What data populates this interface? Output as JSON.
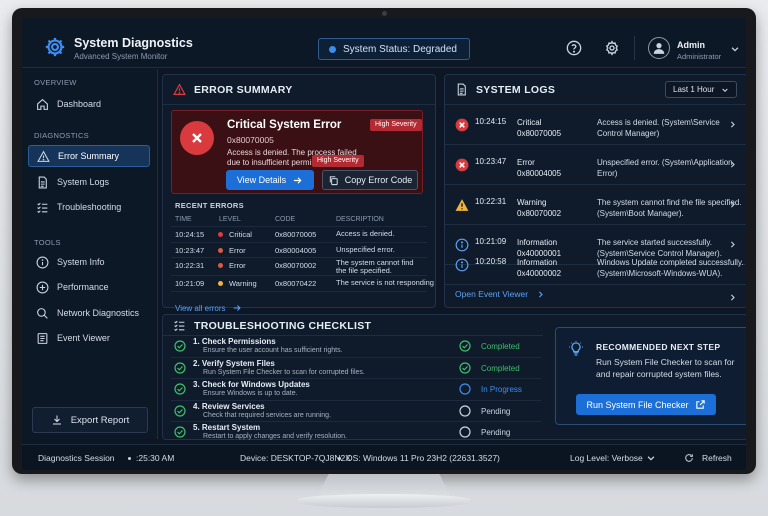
{
  "app": {
    "title": "System Diagnostics",
    "subtitle": "Advanced System Monitor"
  },
  "status": {
    "text": "System Status: Degraded",
    "color": "#3b8ef0"
  },
  "user": {
    "name": "Admin",
    "role": "Administrator"
  },
  "header_icons": [
    "help-icon",
    "gear-icon",
    "user-icon",
    "chevron-down-icon"
  ],
  "sidebar": {
    "overview_label": "OVERVIEW",
    "diagnostics_label": "DIAGNOSTICS",
    "tools_label": "TOOLS",
    "items": [
      {
        "label": "Dashboard",
        "icon": "home-icon"
      },
      {
        "label": "Error Summary",
        "icon": "warning-icon",
        "active": true
      },
      {
        "label": "System Logs",
        "icon": "document-icon"
      },
      {
        "label": "Troubleshooting",
        "icon": "checklist-icon"
      },
      {
        "label": "System Info",
        "icon": "info-icon"
      },
      {
        "label": "Performance",
        "icon": "plus-circle-icon"
      },
      {
        "label": "Network Diagnostics",
        "icon": "search-icon"
      },
      {
        "label": "Event Viewer",
        "icon": "list-icon"
      }
    ],
    "export_label": "Export Report"
  },
  "error_summary": {
    "title": "ERROR SUMMARY",
    "card": {
      "title": "Critical System Error",
      "code": "0x80070005",
      "message": "Access is denied. The process failed due to insufficient permissions.",
      "severity": "High Severity",
      "view_details": "View Details",
      "copy_code": "Copy Error Code",
      "accent": "#d93a3e"
    },
    "recent_label": "RECENT ERRORS",
    "columns": [
      "TIME",
      "LEVEL",
      "CODE",
      "DESCRIPTION"
    ],
    "rows": [
      {
        "time": "10:24:15",
        "level": "Critical",
        "code": "0x80070005",
        "desc": "Access is denied.",
        "color": "#e0393e"
      },
      {
        "time": "10:23:47",
        "level": "Error",
        "code": "0x80004005",
        "desc": "Unspecified error.",
        "color": "#e05a3a"
      },
      {
        "time": "10:22:31",
        "level": "Error",
        "code": "0x80070002",
        "desc": "The system cannot find the file specified.",
        "color": "#e05a3a"
      },
      {
        "time": "10:21:09",
        "level": "Warning",
        "code": "0x80070422",
        "desc": "The service is not responding",
        "color": "#f0b43c"
      }
    ],
    "view_all": "View all errors"
  },
  "system_logs": {
    "title": "SYSTEM LOGS",
    "range": "Last 1 Hour",
    "rows": [
      {
        "time": "10:24:15",
        "level": "Critical",
        "code": "0x80070005",
        "desc": "Access is denied. (System\\Service Control Manager)",
        "icon": "error-icon"
      },
      {
        "time": "10:23:47",
        "level": "Error",
        "code": "0x80004005",
        "desc": "Unspecified error. (System\\Application Error)",
        "icon": "error-icon"
      },
      {
        "time": "10:22:31",
        "level": "Warning",
        "code": "0x80070002",
        "desc": "The system cannot find the file specified. (System\\Boot Manager).",
        "icon": "warning-icon"
      },
      {
        "time": "10:21:09",
        "level": "Information",
        "code": "0x40000001",
        "desc": "The service started successfully. (System\\Service Control Manager).",
        "icon": "info-icon"
      },
      {
        "time": "10:20:58",
        "level": "Information",
        "code": "0x40000002",
        "desc": "Windows Update completed successfully. (System\\Microsoft-Windows-WUA).",
        "icon": "info-icon"
      }
    ],
    "open_viewer": "Open Event Viewer"
  },
  "checklist": {
    "title": "TROUBLESHOOTING CHECKLIST",
    "items": [
      {
        "title": "1. Check Permissions",
        "desc": "Ensure the user account has sufficient rights.",
        "status": "Completed",
        "state": "done"
      },
      {
        "title": "2. Verify System Files",
        "desc": "Run System File Checker to scan for corrupted files.",
        "status": "Completed",
        "state": "done"
      },
      {
        "title": "3. Check for Windows Updates",
        "desc": "Ensure Windows is up to date.",
        "status": "In Progress",
        "state": "progress"
      },
      {
        "title": "4. Review Services",
        "desc": "Check that required services are running.",
        "status": "Pending",
        "state": "pending"
      },
      {
        "title": "5. Restart System",
        "desc": "Restart to apply changes and verify resolution.",
        "status": "Pending",
        "state": "pending"
      }
    ],
    "recommended": {
      "title": "RECOMMENDED NEXT STEP",
      "text": "Run System File Checker to scan for and repair corrupted system files.",
      "button": "Run System File Checker"
    }
  },
  "footer": {
    "session": "Diagnostics Session",
    "time": ":25:30 AM",
    "device": "Device: DESKTOP-7QJ8N2X",
    "os": "OS: Windows 11 Pro 23H2 (22631.3527)",
    "log_level": "Log Level: Verbose",
    "refresh": "Refresh"
  },
  "colors": {
    "completed": "#3fbf6a",
    "progress": "#3b8ef0",
    "pending": "#c9d3e1",
    "critical": "#d93a3e",
    "warning": "#f0b43c"
  }
}
